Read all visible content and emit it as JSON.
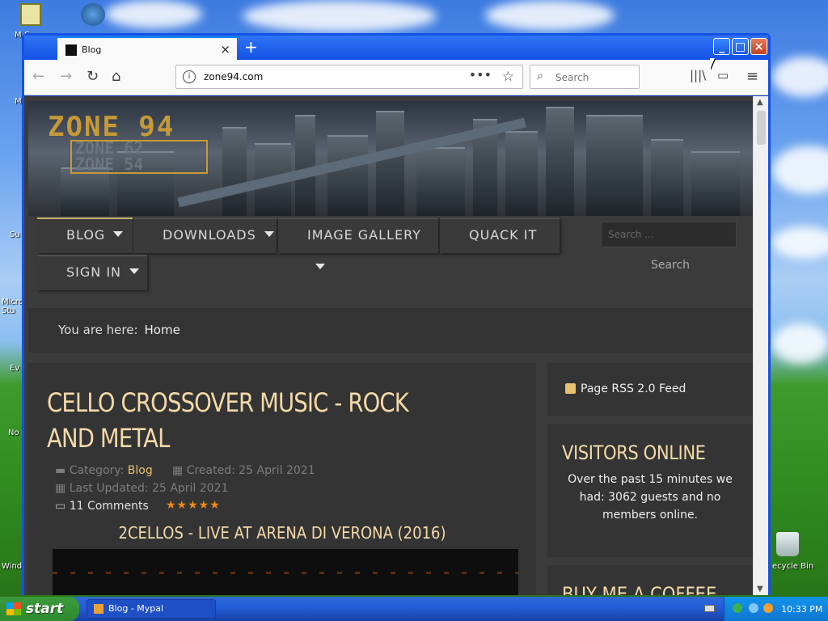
{
  "desktop": {
    "icons_left": [
      "M C",
      "M",
      "Su",
      "Micro Stu",
      "Ev",
      "No",
      "Wind"
    ],
    "recycle_bin": "ecycle Bin"
  },
  "browser": {
    "tab_title": "Blog",
    "new_tab": "+",
    "url": "zone94.com",
    "search_placeholder": "Search"
  },
  "site": {
    "logo_primary": "ZONE 94",
    "logo_secondary": [
      "ZONE 62",
      "ZONE 54"
    ],
    "menu": [
      {
        "label": "BLOG",
        "has_dropdown": true,
        "active": true
      },
      {
        "label": "DOWNLOADS",
        "has_dropdown": true
      },
      {
        "label": "IMAGE GALLERY",
        "has_dropdown": true
      },
      {
        "label": "QUACK IT",
        "has_dropdown": false
      },
      {
        "label": "SIGN IN",
        "has_dropdown": true
      }
    ],
    "search_placeholder": "Search ...",
    "search_button": "Search",
    "breadcrumb_prefix": "You are here:",
    "breadcrumb_current": "Home",
    "article": {
      "title": "CELLO CROSSOVER MUSIC - ROCK AND METAL",
      "category_label": "Category:",
      "category_value": "Blog",
      "created": "Created: 25 April 2021",
      "updated": "Last Updated: 25 April 2021",
      "comments": "11 Comments",
      "rating": 5,
      "stars": "★★★★★",
      "subtitle": "2CELLOS - LIVE AT ARENA DI VERONA (2016)"
    },
    "sidebar": {
      "rss": "Page RSS 2.0 Feed",
      "visitors_title": "VISITORS ONLINE",
      "visitors_text": "Over the past 15 minutes we had: 3062 guests and no members online.",
      "coffee_title": "BUY ME A COFFEE"
    }
  },
  "taskbar": {
    "start": "start",
    "task": "Blog - Mypal",
    "clock": "10:33 PM"
  }
}
